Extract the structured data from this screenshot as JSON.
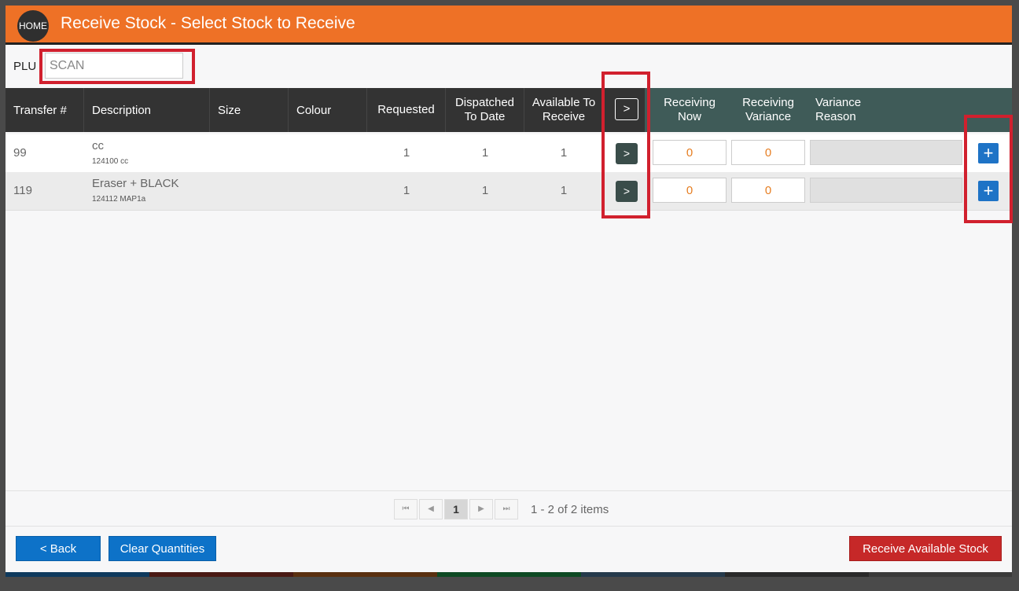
{
  "header": {
    "home_label": "HOME",
    "title": "Receive Stock - Select Stock to Receive"
  },
  "plu": {
    "label": "PLU",
    "placeholder": "SCAN"
  },
  "table": {
    "columns": {
      "transfer": "Transfer #",
      "description": "Description",
      "size": "Size",
      "colour": "Colour",
      "requested": "Requested",
      "dispatched": "Dispatched\nTo Date",
      "available": "Available To\nReceive",
      "receive_all": ">",
      "receiving_now": "Receiving\nNow",
      "receiving_variance": "Receiving\nVariance",
      "variance_reason": "Variance\nReason"
    },
    "rows": [
      {
        "transfer": "99",
        "description": "cc",
        "sub": "124100  cc",
        "size": "",
        "colour": "",
        "requested": "1",
        "dispatched": "1",
        "available": "1",
        "arrow": ">",
        "receiving_now": "0",
        "receiving_variance": "0",
        "plus": "+"
      },
      {
        "transfer": "119",
        "description": "Eraser + BLACK",
        "sub": "124112  MAP1a",
        "size": "",
        "colour": "",
        "requested": "1",
        "dispatched": "1",
        "available": "1",
        "arrow": ">",
        "receiving_now": "0",
        "receiving_variance": "0",
        "plus": "+"
      }
    ]
  },
  "pager": {
    "first": "⏮",
    "prev": "◀",
    "page": "1",
    "next": "▶",
    "last": "⏭",
    "info": "1 - 2 of 2 items"
  },
  "footer": {
    "back": "< Back",
    "clear": "Clear Quantities",
    "receive_all": "Receive Available Stock"
  },
  "colors": {
    "header": "#ee7126",
    "table_header": "#333333",
    "table_header_accent": "#3f5b58",
    "primary": "#0d72c8",
    "danger": "#c62828",
    "quantity_text": "#e67e22"
  }
}
